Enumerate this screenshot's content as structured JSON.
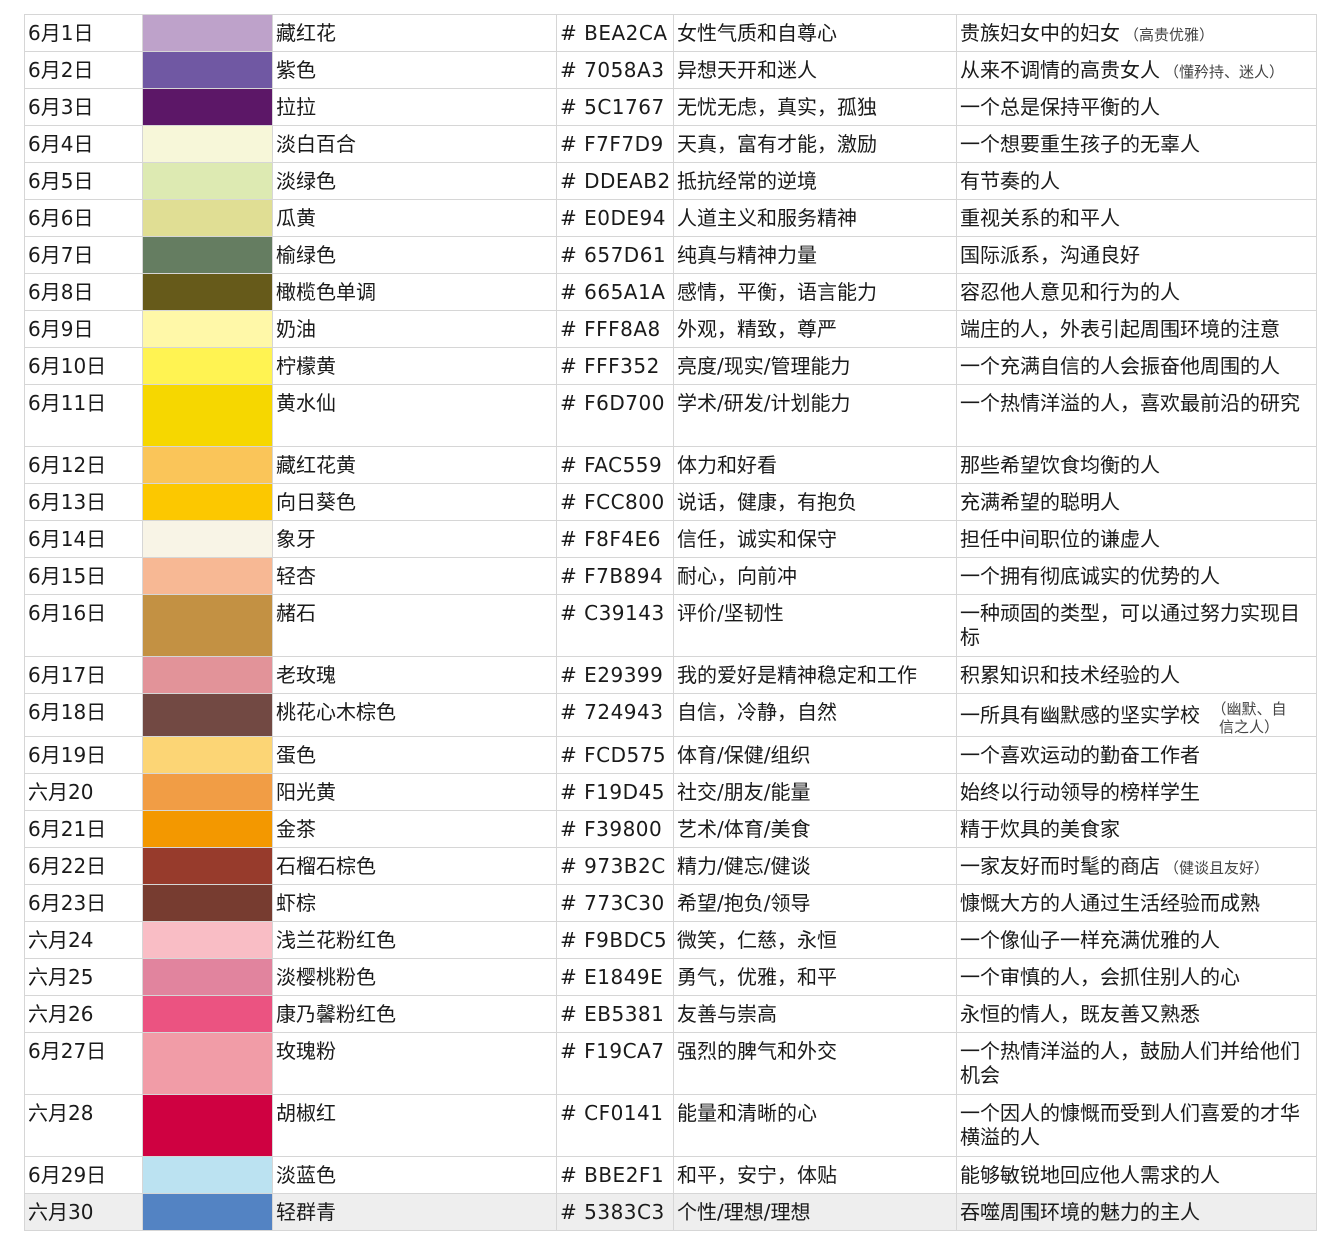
{
  "rows": [
    {
      "date": "6月1日",
      "color_name": "藏红花",
      "hex": "# BEA2CA",
      "swatch": "#BEA2CA",
      "traits": "女性气质和自尊心",
      "desc": "贵族妇女中的妇女",
      "note": "（高贵优雅）"
    },
    {
      "date": "6月2日",
      "color_name": "紫色",
      "hex": "# 7058A3",
      "swatch": "#7058A3",
      "traits": "异想天开和迷人",
      "desc": "从来不调情的高贵女人",
      "note": "（懂矜持、迷人）"
    },
    {
      "date": "6月3日",
      "color_name": "拉拉",
      "hex": "# 5C1767",
      "swatch": "#5C1767",
      "traits": "无忧无虑，真实，孤独",
      "desc": "一个总是保持平衡的人",
      "note": ""
    },
    {
      "date": "6月4日",
      "color_name": "淡白百合",
      "hex": "# F7F7D9",
      "swatch": "#F7F7D9",
      "traits": "天真，富有才能，激励",
      "desc": "一个想要重生孩子的无辜人",
      "note": ""
    },
    {
      "date": "6月5日",
      "color_name": "淡绿色",
      "hex": "# DDEAB2",
      "swatch": "#DDEAB2",
      "traits": "抵抗经常的逆境",
      "desc": "有节奏的人",
      "note": ""
    },
    {
      "date": "6月6日",
      "color_name": "瓜黄",
      "hex": "# E0DE94",
      "swatch": "#E0DE94",
      "traits": "人道主义和服务精神",
      "desc": "重视关系的和平人",
      "note": ""
    },
    {
      "date": "6月7日",
      "color_name": "榆绿色",
      "hex": "# 657D61",
      "swatch": "#657D61",
      "traits": "纯真与精神力量",
      "desc": "国际派系，沟通良好",
      "note": ""
    },
    {
      "date": "6月8日",
      "color_name": "橄榄色单调",
      "hex": "# 665A1A",
      "swatch": "#665A1A",
      "traits": "感情，平衡，语言能力",
      "desc": "容忍他人意见和行为的人",
      "note": ""
    },
    {
      "date": "6月9日",
      "color_name": "奶油",
      "hex": "# FFF8A8",
      "swatch": "#FFF8A8",
      "traits": "外观，精致，尊严",
      "desc": "端庄的人，外表引起周围环境的注意",
      "note": ""
    },
    {
      "date": "6月10日",
      "color_name": "柠檬黄",
      "hex": "# FFF352",
      "swatch": "#FFF352",
      "traits": "亮度/现实/管理能力",
      "desc": "一个充满自信的人会振奋他周围的人",
      "note": ""
    },
    {
      "date": "6月11日",
      "color_name": "黄水仙",
      "hex": "# F6D700",
      "swatch": "#F6D700",
      "traits": "学术/研发/计划能力",
      "desc": "一个热情洋溢的人，喜欢最前沿的研究",
      "note": "",
      "tall": true
    },
    {
      "date": "6月12日",
      "color_name": "藏红花黄",
      "hex": "# FAC559",
      "swatch": "#FAC559",
      "traits": "体力和好看",
      "desc": "那些希望饮食均衡的人",
      "note": ""
    },
    {
      "date": "6月13日",
      "color_name": "向日葵色",
      "hex": "# FCC800",
      "swatch": "#FCC800",
      "traits": "说话，健康，有抱负",
      "desc": "充满希望的聪明人",
      "note": ""
    },
    {
      "date": "6月14日",
      "color_name": "象牙",
      "hex": "# F8F4E6",
      "swatch": "#F8F4E6",
      "traits": "信任，诚实和保守",
      "desc": "担任中间职位的谦虚人",
      "note": ""
    },
    {
      "date": "6月15日",
      "color_name": "轻杏",
      "hex": "# F7B894",
      "swatch": "#F7B894",
      "traits": "耐心，向前冲",
      "desc": "一个拥有彻底诚实的优势的人",
      "note": ""
    },
    {
      "date": "6月16日",
      "color_name": "赭石",
      "hex": "# C39143",
      "swatch": "#C39143",
      "traits": "评价/坚韧性",
      "desc": "一种顽固的类型，可以通过努力实现目标",
      "note": "",
      "tall": true
    },
    {
      "date": "6月17日",
      "color_name": "老玫瑰",
      "hex": "# E29399",
      "swatch": "#E29399",
      "traits": "我的爱好是精神稳定和工作",
      "desc": "积累知识和技术经验的人",
      "note": ""
    },
    {
      "date": "6月18日",
      "color_name": "桃花心木棕色",
      "hex": "# 724943",
      "swatch": "#724943",
      "traits": "自信，冷静，自然",
      "desc": "一所具有幽默感的坚实学校",
      "note": "（幽默、自信之人）",
      "stack": true
    },
    {
      "date": "6月19日",
      "color_name": "蛋色",
      "hex": "# FCD575",
      "swatch": "#FCD575",
      "traits": "体育/保健/组织",
      "desc": "一个喜欢运动的勤奋工作者",
      "note": ""
    },
    {
      "date": "六月20",
      "color_name": "阳光黄",
      "hex": "# F19D45",
      "swatch": "#F19D45",
      "traits": "社交/朋友/能量",
      "desc": "始终以行动领导的榜样学生",
      "note": ""
    },
    {
      "date": "6月21日",
      "color_name": "金茶",
      "hex": "# F39800",
      "swatch": "#F39800",
      "traits": "艺术/体育/美食",
      "desc": "精于炊具的美食家",
      "note": ""
    },
    {
      "date": "6月22日",
      "color_name": "石榴石棕色",
      "hex": "# 973B2C",
      "swatch": "#973B2C",
      "traits": "精力/健忘/健谈",
      "desc": "一家友好而时髦的商店",
      "note": "（健谈且友好）"
    },
    {
      "date": "6月23日",
      "color_name": "虾棕",
      "hex": "# 773C30",
      "swatch": "#773C30",
      "traits": "希望/抱负/领导",
      "desc": "慷慨大方的人通过生活经验而成熟",
      "note": ""
    },
    {
      "date": "六月24",
      "color_name": "浅兰花粉红色",
      "hex": "# F9BDC5",
      "swatch": "#F9BDC5",
      "traits": "微笑，仁慈，永恒",
      "desc": "一个像仙子一样充满优雅的人",
      "note": ""
    },
    {
      "date": "六月25",
      "color_name": "淡樱桃粉色",
      "hex": "# E1849E",
      "swatch": "#E1849E",
      "traits": "勇气，优雅，和平",
      "desc": "一个审慎的人，会抓住别人的心",
      "note": ""
    },
    {
      "date": "六月26",
      "color_name": "康乃馨粉红色",
      "hex": "# EB5381",
      "swatch": "#EB5381",
      "traits": "友善与崇高",
      "desc": "永恒的情人，既友善又熟悉",
      "note": ""
    },
    {
      "date": "6月27日",
      "color_name": "玫瑰粉",
      "hex": "# F19CA7",
      "swatch": "#F19CA7",
      "traits": "强烈的脾气和外交",
      "desc": "一个热情洋溢的人，鼓励人们并给他们机会",
      "note": "",
      "tall": true
    },
    {
      "date": "六月28",
      "color_name": "胡椒红",
      "hex": "# CF0141",
      "swatch": "#CF0141",
      "traits": "能量和清晰的心",
      "desc": "一个因人的慷慨而受到人们喜爱的才华横溢的人",
      "note": "",
      "tall": true
    },
    {
      "date": "6月29日",
      "color_name": "淡蓝色",
      "hex": "# BBE2F1",
      "swatch": "#BBE2F1",
      "traits": "和平，安宁，体贴",
      "desc": "能够敏锐地回应他人需求的人",
      "note": ""
    },
    {
      "date": "六月30",
      "color_name": "轻群青",
      "hex": "# 5383C3",
      "swatch": "#5383C3",
      "traits": "个性/理想/理想",
      "desc": "吞噬周围环境的魅力的主人",
      "note": ""
    }
  ]
}
